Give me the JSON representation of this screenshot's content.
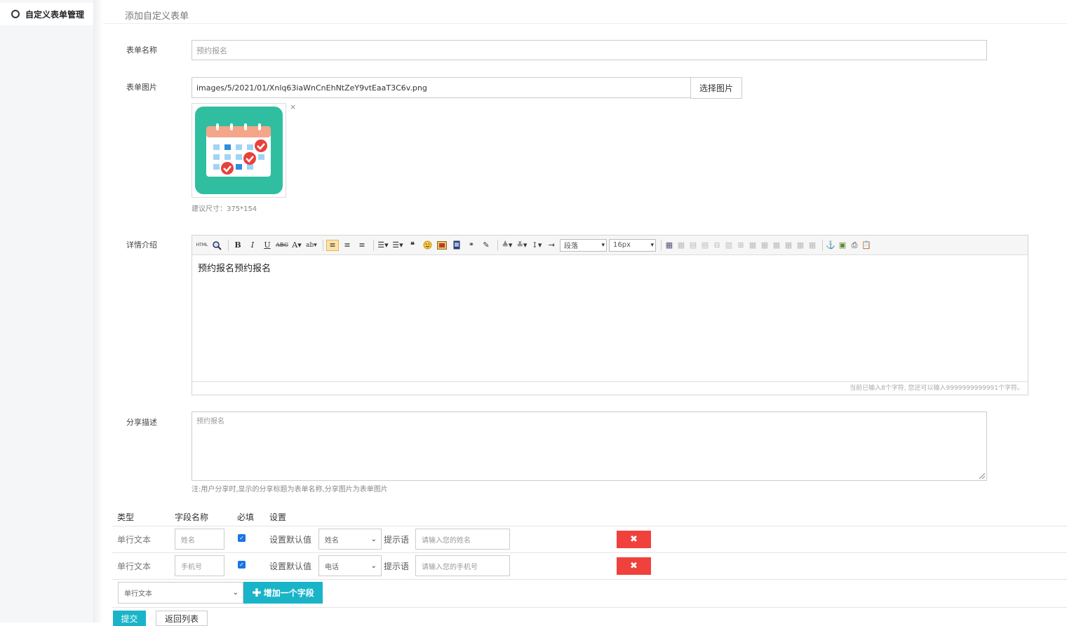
{
  "sidebar": {
    "item_label": "自定义表单管理"
  },
  "page": {
    "title": "添加自定义表单"
  },
  "form": {
    "name_label": "表单名称",
    "name_placeholder": "预约报名",
    "image_label": "表单图片",
    "image_path": "images/5/2021/01/Xnlq63iaWnCnEhNtZeY9vtEaaT3C6v.png",
    "select_image_button": "选择图片",
    "remove_image": "×",
    "size_hint": "建议尺寸：375*154",
    "detail_label": "详情介绍",
    "editor": {
      "paragraph_select": "段落",
      "font_size_select": "16px",
      "content": "预约报名预约报名",
      "counter": "当前已输入8个字符, 您还可以输入9999999999991个字符。"
    },
    "share_label": "分享描述",
    "share_placeholder": "预约报名",
    "share_note": "注:用户分享时,显示的分享标题为表单名称,分享图片为表单图片"
  },
  "fields_table": {
    "headers": {
      "type": "类型",
      "name": "字段名称",
      "required": "必填",
      "settings": "设置"
    },
    "rows": [
      {
        "type": "单行文本",
        "name_placeholder": "姓名",
        "default_label": "设置默认值",
        "default_value": "姓名",
        "prompt_label": "提示语",
        "prompt_placeholder": "请输入您的姓名"
      },
      {
        "type": "单行文本",
        "name_placeholder": "手机号",
        "default_label": "设置默认值",
        "default_value": "电话",
        "prompt_label": "提示语",
        "prompt_placeholder": "请输入您的手机号"
      }
    ],
    "new_field_type": "单行文本",
    "add_field_button": "增加一个字段"
  },
  "actions": {
    "submit": "提交",
    "back": "返回列表"
  },
  "colors": {
    "accent": "#1ab4c9",
    "danger": "#f0413d",
    "checkbox": "#1a73e8",
    "calendar_bg": "#2fbfa0"
  }
}
